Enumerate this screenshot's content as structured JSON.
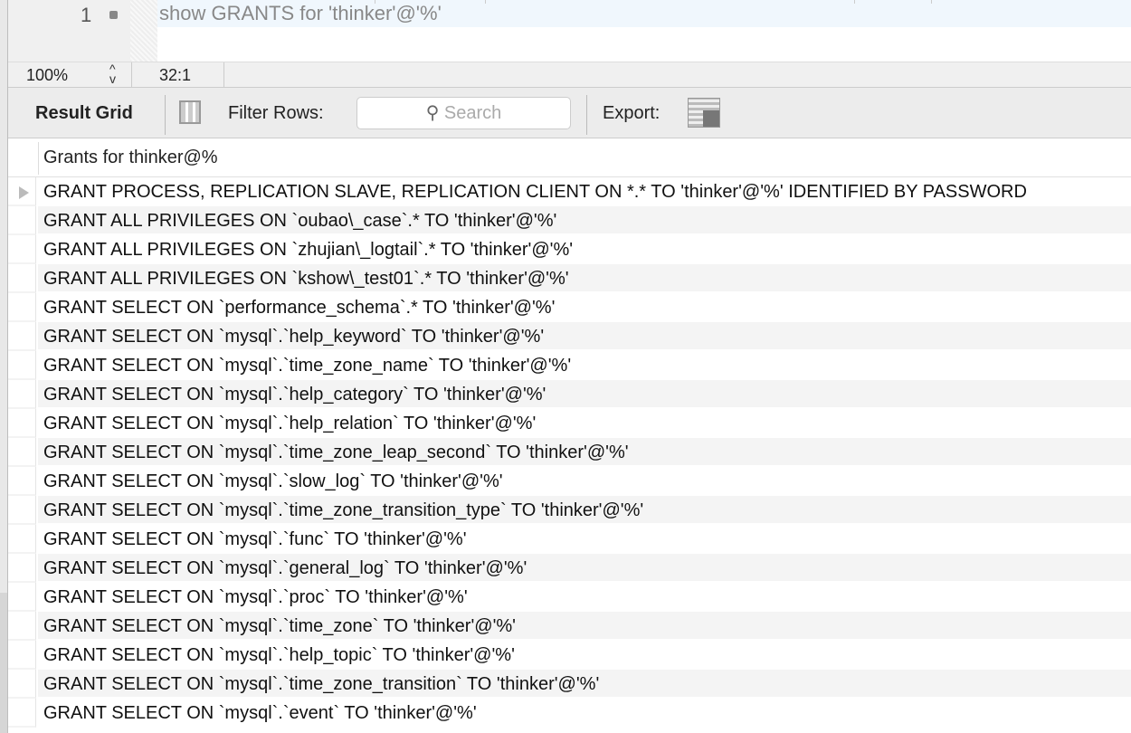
{
  "editor": {
    "line_number": "1",
    "code": "show GRANTS for 'thinker'@'%'"
  },
  "status": {
    "zoom": "100%",
    "position": "32:1"
  },
  "toolbar": {
    "result_grid": "Result Grid",
    "filter_rows": "Filter Rows:",
    "search_placeholder": "Search",
    "export": "Export:"
  },
  "grid": {
    "column": "Grants for thinker@%",
    "rows": [
      "GRANT PROCESS, REPLICATION SLAVE, REPLICATION CLIENT ON *.* TO 'thinker'@'%' IDENTIFIED BY PASSWORD",
      "GRANT ALL PRIVILEGES ON `oubao\\_case`.* TO 'thinker'@'%'",
      "GRANT ALL PRIVILEGES ON `zhujian\\_logtail`.* TO 'thinker'@'%'",
      "GRANT ALL PRIVILEGES ON `kshow\\_test01`.* TO 'thinker'@'%'",
      "GRANT SELECT ON `performance_schema`.* TO 'thinker'@'%'",
      "GRANT SELECT ON `mysql`.`help_keyword` TO 'thinker'@'%'",
      "GRANT SELECT ON `mysql`.`time_zone_name` TO 'thinker'@'%'",
      "GRANT SELECT ON `mysql`.`help_category` TO 'thinker'@'%'",
      "GRANT SELECT ON `mysql`.`help_relation` TO 'thinker'@'%'",
      "GRANT SELECT ON `mysql`.`time_zone_leap_second` TO 'thinker'@'%'",
      "GRANT SELECT ON `mysql`.`slow_log` TO 'thinker'@'%'",
      "GRANT SELECT ON `mysql`.`time_zone_transition_type` TO 'thinker'@'%'",
      "GRANT SELECT ON `mysql`.`func` TO 'thinker'@'%'",
      "GRANT SELECT ON `mysql`.`general_log` TO 'thinker'@'%'",
      "GRANT SELECT ON `mysql`.`proc` TO 'thinker'@'%'",
      "GRANT SELECT ON `mysql`.`time_zone` TO 'thinker'@'%'",
      "GRANT SELECT ON `mysql`.`help_topic` TO 'thinker'@'%'",
      "GRANT SELECT ON `mysql`.`time_zone_transition` TO 'thinker'@'%'",
      "GRANT SELECT ON `mysql`.`event` TO 'thinker'@'%'"
    ]
  }
}
